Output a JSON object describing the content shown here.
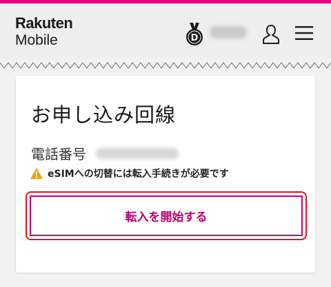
{
  "header": {
    "logo_top": "Rakuten",
    "logo_bottom": "Mobile",
    "medal_letter": "D"
  },
  "card": {
    "title": "お申し込み回線",
    "phone_label": "電話番号",
    "warning_text": "eSIMへの切替には転入手続きが必要です",
    "button_label": "転入を開始する"
  },
  "colors": {
    "brand": "#e5007e",
    "button_text": "#bf0073",
    "highlight": "#e0141e",
    "warning": "#e8a317"
  }
}
